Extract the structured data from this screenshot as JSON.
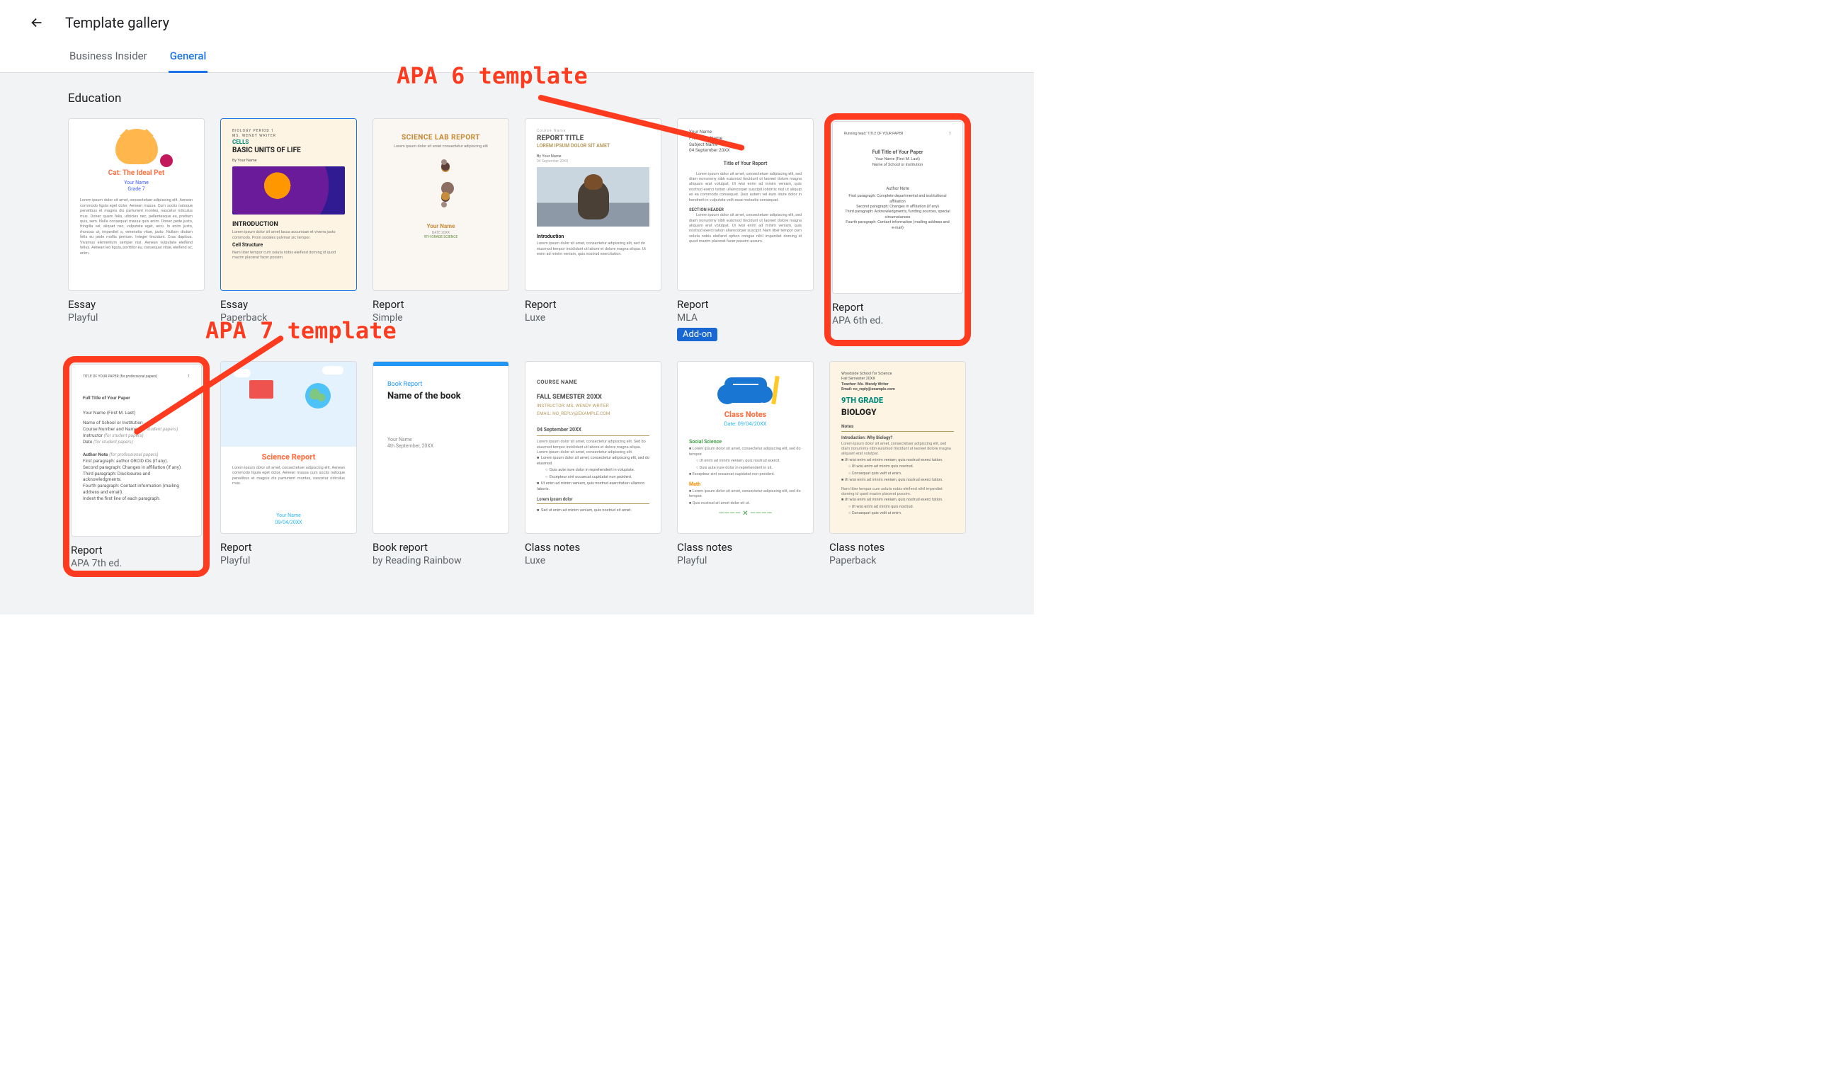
{
  "header": {
    "title": "Template gallery"
  },
  "tabs": [
    {
      "label": "Business Insider",
      "active": false
    },
    {
      "label": "General",
      "active": true
    }
  ],
  "section": {
    "title": "Education"
  },
  "annotations": {
    "apa6": "APA 6 template",
    "apa7": "APA 7 template"
  },
  "templates": [
    {
      "title": "Essay",
      "subtitle": "Playful",
      "thumb_kind": "essay-playful",
      "thumb": {
        "heading": "Cat: The Ideal Pet",
        "byline": "Your Name",
        "grade": "Grade 7"
      }
    },
    {
      "title": "Essay",
      "subtitle": "Paperback",
      "selected": true,
      "thumb_kind": "essay-paperback",
      "thumb": {
        "tag": "BIOLOGY PERIOD 1",
        "teacher": "MS. WENDY WRITER",
        "subhead": "CELLS",
        "heading": "BASIC UNITS OF LIFE",
        "byline": "By Your Name",
        "section1": "INTRODUCTION",
        "section2": "Cell Structure"
      }
    },
    {
      "title": "Report",
      "subtitle": "Simple",
      "thumb_kind": "simple",
      "thumb": {
        "heading": "SCIENCE LAB REPORT",
        "name": "Your Name",
        "meta1": "DATE 20XX",
        "meta2": "9TH GRADE SCIENCE"
      }
    },
    {
      "title": "Report",
      "subtitle": "Luxe",
      "thumb_kind": "luxe",
      "thumb": {
        "pre": "Course Name",
        "heading": "REPORT TITLE",
        "subheading": "LOREM IPSUM DOLOR SIT AMET",
        "byline": "By Your Name",
        "date": "04 September 20XX",
        "section": "Introduction"
      }
    },
    {
      "title": "Report",
      "subtitle": "MLA",
      "addon": "Add-on",
      "thumb_kind": "mla",
      "thumb": {
        "l1": "Your Name",
        "l2": "Professor Name",
        "l3": "Subject Name",
        "l4": "04 September 20XX",
        "heading": "Title of Your Report",
        "section": "SECTION HEADER"
      }
    },
    {
      "title": "Report",
      "subtitle": "APA 6th ed.",
      "highlight": true,
      "thumb_kind": "apa6",
      "thumb": {
        "running": "Running head: TITLE OF YOUR PAPER",
        "page": "1",
        "heading": "Full Title of Your Paper",
        "author": "Your Name (First M. Last)",
        "school": "Name of School or Institution",
        "note": "Author Note",
        "p1": "First paragraph: Complete departmental and institutional affiliation",
        "p2": "Second paragraph: Changes in affiliation (if any)",
        "p3": "Third paragraph: Acknowledgments, funding sources, special circumstances",
        "p4": "Fourth paragraph: Contact information (mailing address and e-mail)"
      }
    },
    {
      "title": "Report",
      "subtitle": "APA 7th ed.",
      "highlight": true,
      "thumb_kind": "apa7",
      "thumb": {
        "hdr_left": "TITLE OF YOUR PAPER",
        "hdr_note": "(for professional papers)",
        "hdr_page": "1",
        "heading": "Full Title of Your Paper",
        "author": "Your Name (First M. Last)",
        "school": "Name of School or Institution",
        "course": "Course Number and Name",
        "instructor": "Instructor",
        "date_label": "Date",
        "note": "Author Note",
        "p1": "First paragraph: author ORCID iDs (if any).",
        "p2": "Second paragraph: Changes in affiliation (if any).",
        "p3": "Third paragraph: Disclosures and acknowledgments.",
        "p4": "Fourth paragraph: Contact information (mailing address and email).",
        "p5": "Indent the first line of each paragraph."
      }
    },
    {
      "title": "Report",
      "subtitle": "Playful",
      "thumb_kind": "report-playful",
      "thumb": {
        "heading": "Science Report",
        "name": "Your Name",
        "date": "09/04/20XX"
      }
    },
    {
      "title": "Book report",
      "subtitle": "by Reading Rainbow",
      "thumb_kind": "bookreport",
      "thumb": {
        "pre": "Book Report",
        "heading": "Name of the book",
        "name": "Your Name",
        "date": "4th September, 20XX"
      }
    },
    {
      "title": "Class notes",
      "subtitle": "Luxe",
      "thumb_kind": "classnotes-luxe",
      "thumb": {
        "pre": "COURSE NAME",
        "heading": "FALL SEMESTER 20XX",
        "teacher": "INSTRUCTOR: MS. WENDY WRITER",
        "email": "EMAIL: NO_REPLY@EXAMPLE.COM",
        "date": "04 September 20XX",
        "note": "Lorem ipsum dolor"
      }
    },
    {
      "title": "Class notes",
      "subtitle": "Playful",
      "thumb_kind": "classnotes-playful",
      "thumb": {
        "heading": "Class Notes",
        "date": "Date: 09/04/20XX",
        "sec1": "Social Science",
        "sec2": "Math"
      }
    },
    {
      "title": "Class notes",
      "subtitle": "Paperback",
      "thumb_kind": "classnotes-paperback",
      "thumb": {
        "l1": "Woodside School for Science",
        "l2": "Fall Semester 20XX",
        "l3": "Teacher: Ms. Wendy Writer",
        "l4": "Email: no_reply@example.com",
        "grade": "9TH GRADE",
        "subject": "BIOLOGY",
        "notes_label": "Notes",
        "intro": "Introduction: Why Biology?"
      }
    }
  ]
}
